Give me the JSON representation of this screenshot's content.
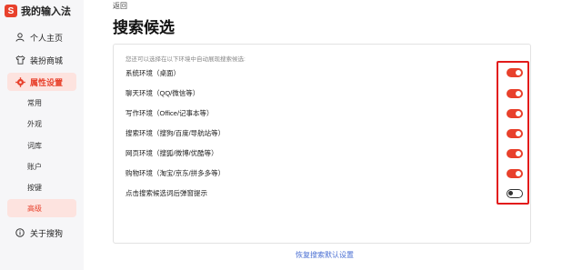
{
  "sidebar": {
    "brand_title": "我的输入法",
    "brand_glyph": "S",
    "items": [
      {
        "label": "个人主页",
        "icon": "person-icon"
      },
      {
        "label": "装扮商城",
        "icon": "shirt-icon"
      },
      {
        "label": "属性设置",
        "icon": "gear-icon",
        "active": true
      },
      {
        "label": "关于搜狗",
        "icon": "info-icon"
      }
    ],
    "sub_items": [
      {
        "label": "常用"
      },
      {
        "label": "外观"
      },
      {
        "label": "词库"
      },
      {
        "label": "账户"
      },
      {
        "label": "按键"
      },
      {
        "label": "高级",
        "active": true
      }
    ]
  },
  "header": {
    "back_label": "返回",
    "title": "搜索候选"
  },
  "panel": {
    "hint": "您还可以选择在以下环境中自动展现搜索候选:",
    "rows": [
      {
        "label": "系统环境（桌面）",
        "enabled": true
      },
      {
        "label": "聊天环境（QQ/微信等）",
        "enabled": true
      },
      {
        "label": "写作环境（Office/记事本等）",
        "enabled": true
      },
      {
        "label": "搜索环境（搜狗/百度/导航站等）",
        "enabled": true
      },
      {
        "label": "网页环境（搜狐/微博/优酷等）",
        "enabled": true
      },
      {
        "label": "购物环境（淘宝/京东/拼多多等）",
        "enabled": true
      },
      {
        "label": "点击搜索候选词后弹窗提示",
        "enabled": false
      }
    ]
  },
  "footer": {
    "restore_label": "恢复搜索默认设置"
  },
  "colors": {
    "accent": "#e8412c",
    "highlight": "#e21b1b",
    "link": "#4a6fd3"
  }
}
